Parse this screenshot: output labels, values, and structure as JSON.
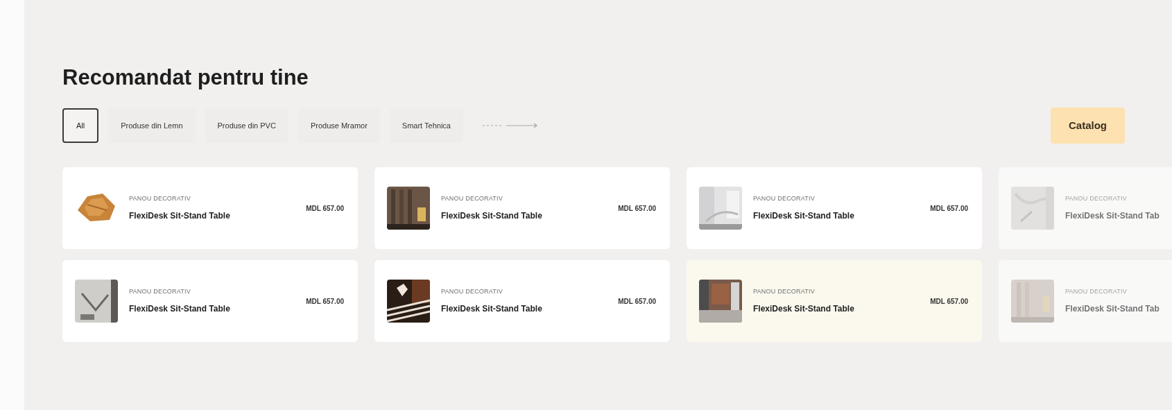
{
  "section": {
    "title": "Recomandat pentru tine"
  },
  "filters": [
    {
      "label": "All",
      "selected": true
    },
    {
      "label": "Produse din Lemn",
      "selected": false
    },
    {
      "label": "Produse din PVC",
      "selected": false
    },
    {
      "label": "Produse Mramor",
      "selected": false
    },
    {
      "label": "Smart Tehnica",
      "selected": false
    }
  ],
  "catalog_button": "Catalog",
  "products": [
    {
      "category": "PANOU DECORATIV",
      "name": "FlexiDesk Sit-Stand Table",
      "price": "MDL 657.00",
      "highlighted": false,
      "dimmed": false
    },
    {
      "category": "PANOU DECORATIV",
      "name": "FlexiDesk Sit-Stand Table",
      "price": "MDL 657.00",
      "highlighted": false,
      "dimmed": false
    },
    {
      "category": "PANOU DECORATIV",
      "name": "FlexiDesk Sit-Stand Table",
      "price": "MDL 657.00",
      "highlighted": false,
      "dimmed": false
    },
    {
      "category": "PANOU DECORATIV",
      "name": "FlexiDesk Sit-Stand Tab",
      "highlighted": false,
      "dimmed": true
    },
    {
      "category": "PANOU DECORATIV",
      "name": "FlexiDesk Sit-Stand Table",
      "price": "MDL 657.00",
      "highlighted": false,
      "dimmed": false
    },
    {
      "category": "PANOU DECORATIV",
      "name": "FlexiDesk Sit-Stand Table",
      "price": "MDL 657.00",
      "highlighted": false,
      "dimmed": false
    },
    {
      "category": "PANOU DECORATIV",
      "name": "FlexiDesk Sit-Stand Table",
      "price": "MDL 657.00",
      "highlighted": true,
      "dimmed": false
    },
    {
      "category": "PANOU DECORATIV",
      "name": "FlexiDesk Sit-Stand Tab",
      "highlighted": false,
      "dimmed": true
    }
  ]
}
